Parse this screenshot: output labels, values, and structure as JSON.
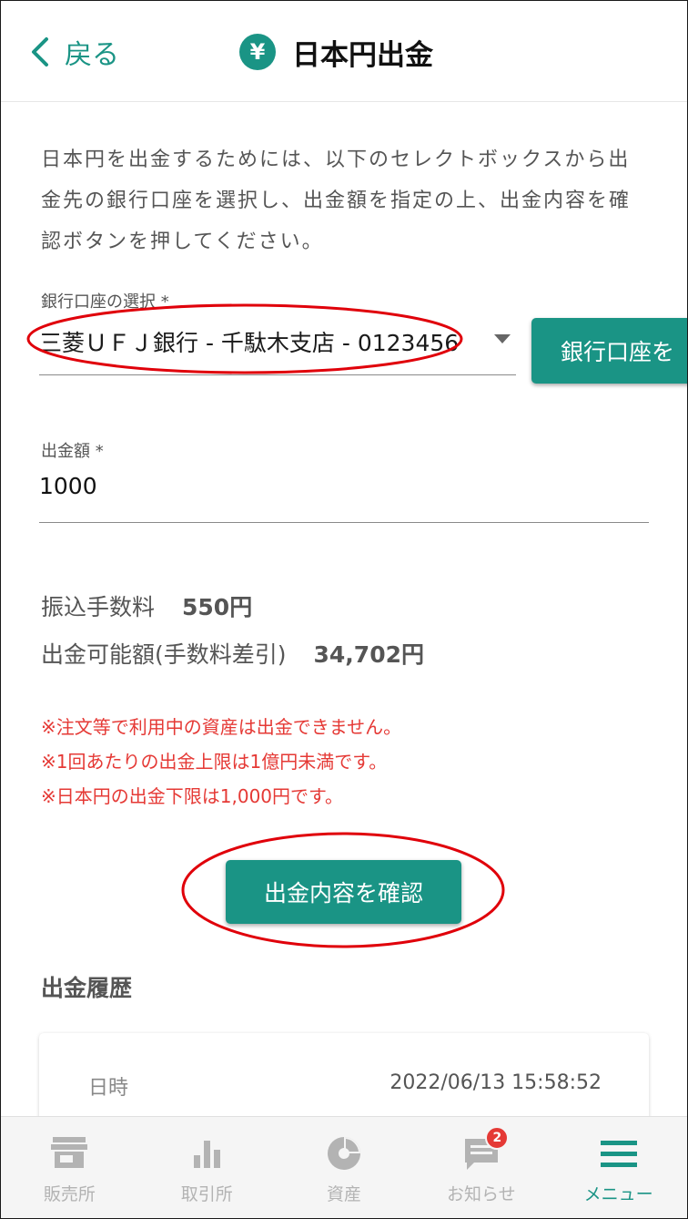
{
  "header": {
    "back_label": "戻る",
    "title": "日本円出金",
    "title_icon": "yen-icon"
  },
  "intro": "日本円を出金するためには、以下のセレクトボックスから出金先の銀行口座を選択し、出金額を指定の上、出金内容を確認ボタンを押してください。",
  "bank_select": {
    "label": "銀行口座の選択 *",
    "value": "三菱ＵＦＪ銀行 - 千駄木支店 - 0123456",
    "add_button_label": "銀行口座を"
  },
  "amount": {
    "label": "出金額 *",
    "value": "1000"
  },
  "fees": {
    "transfer_fee_label": "振込手数料",
    "transfer_fee_value": "550円",
    "available_label": "出金可能額(手数料差引)",
    "available_value": "34,702円"
  },
  "notes": [
    "※注文等で利用中の資産は出金できません。",
    "※1回あたりの出金上限は1億円未満です。",
    "※日本円の出金下限は1,000円です。"
  ],
  "confirm_button_label": "出金内容を確認",
  "history": {
    "title": "出金履歴",
    "rows": [
      {
        "key": "日時",
        "value": "2022/06/13 15:58:52"
      }
    ]
  },
  "bottom_nav": {
    "items": [
      {
        "label": "販売所",
        "icon": "store-icon"
      },
      {
        "label": "取引所",
        "icon": "bar-chart-icon"
      },
      {
        "label": "資産",
        "icon": "pie-chart-icon"
      },
      {
        "label": "お知らせ",
        "icon": "message-icon",
        "badge": "2"
      },
      {
        "label": "メニュー",
        "icon": "menu-icon"
      }
    ]
  },
  "colors": {
    "accent": "#1a9485",
    "warning": "#e53935",
    "annotation": "#e0000a"
  }
}
